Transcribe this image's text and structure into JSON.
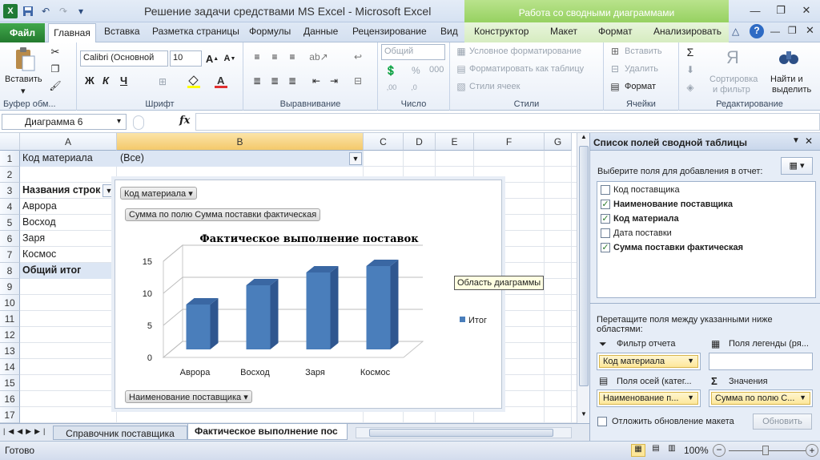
{
  "window": {
    "title": "Решение задачи средствами MS Excel  -  Microsoft Excel",
    "context_group": "Работа со сводными диаграммами"
  },
  "ribbon_tabs": {
    "file": "Файл",
    "home": "Главная",
    "insert": "Вставка",
    "page_layout": "Разметка страницы",
    "formulas": "Формулы",
    "data": "Данные",
    "review": "Рецензирование",
    "view": "Вид",
    "design": "Конструктор",
    "layout": "Макет",
    "format": "Формат",
    "analyze": "Анализировать"
  },
  "ribbon": {
    "clipboard": {
      "paste": "Вставить",
      "label": "Буфер обм..."
    },
    "font": {
      "name": "Calibri (Основной",
      "size": "10",
      "label": "Шрифт",
      "bold": "Ж",
      "italic": "К",
      "underline": "Ч"
    },
    "alignment": {
      "label": "Выравнивание"
    },
    "number": {
      "format": "Общий",
      "label": "Число",
      "percent": "%",
      "thousands": "000"
    },
    "styles": {
      "conditional": "Условное форматирование",
      "as_table": "Форматировать как таблицу",
      "cell_styles": "Стили ячеек",
      "label": "Стили"
    },
    "cells": {
      "insert": "Вставить",
      "delete": "Удалить",
      "format": "Формат",
      "label": "Ячейки"
    },
    "editing": {
      "sort": "Сортировка",
      "sort2": "и фильтр",
      "find": "Найти и",
      "find2": "выделить",
      "label": "Редактирование"
    }
  },
  "formula_bar": {
    "name_box": "Диаграмма 6",
    "fx": "fx",
    "value": ""
  },
  "columns": [
    "A",
    "B",
    "C",
    "D",
    "E",
    "F",
    "G"
  ],
  "rows": [
    "1",
    "2",
    "3",
    "4",
    "5",
    "6",
    "7",
    "8",
    "9",
    "10",
    "11",
    "12",
    "13",
    "14",
    "15",
    "16",
    "17"
  ],
  "cells": {
    "a1": "Код материала",
    "b1": "(Все)",
    "a3": "Названия строк",
    "a4": "Аврора",
    "a5": "Восход",
    "a6": "Заря",
    "a7": "Космос",
    "a8": "Общий итог"
  },
  "chart": {
    "filter_button": "Код материала",
    "value_button": "Сумма по полю Сумма поставки фактическая",
    "axis_button": "Наименование поставщика",
    "tooltip": "Область диаграммы"
  },
  "chart_data": {
    "type": "bar",
    "title": "Фактическое выполнение поставок",
    "categories": [
      "Аврора",
      "Восход",
      "Заря",
      "Космос"
    ],
    "series": [
      {
        "name": "Итог",
        "values": [
          7,
          10,
          12,
          13
        ]
      }
    ],
    "yticks": [
      "0",
      "5",
      "10",
      "15"
    ],
    "ylim": [
      0,
      15
    ],
    "legend": "right",
    "grid": true,
    "colors": {
      "bar": "#4a7ebb",
      "bar_side": "#2f568f",
      "bar_top": "#3a67a3"
    }
  },
  "sheet_tabs": {
    "tab1": "Справочник поставщика",
    "tab2": "Фактическое выполнение пос"
  },
  "status": {
    "ready": "Готово",
    "zoom": "100%"
  },
  "pivot_panel": {
    "title": "Список полей сводной таблицы",
    "choose": "Выберите поля для добавления в отчет:",
    "fields": [
      {
        "label": "Код поставщика",
        "checked": false
      },
      {
        "label": "Наименование поставщика",
        "checked": true
      },
      {
        "label": "Код материала",
        "checked": true
      },
      {
        "label": "Дата поставки",
        "checked": false
      },
      {
        "label": "Сумма поставки фактическая",
        "checked": true
      }
    ],
    "drag_hint": "Перетащите поля между указанными ниже областями:",
    "report_filter": "Фильтр отчета",
    "legend_fields": "Поля легенды (ря...",
    "axis_fields": "Поля осей (катег...",
    "values": "Значения",
    "filter_item": "Код материала",
    "axis_item": "Наименование п...",
    "values_item": "Сумма по полю С...",
    "defer": "Отложить обновление макета",
    "update": "Обновить"
  }
}
